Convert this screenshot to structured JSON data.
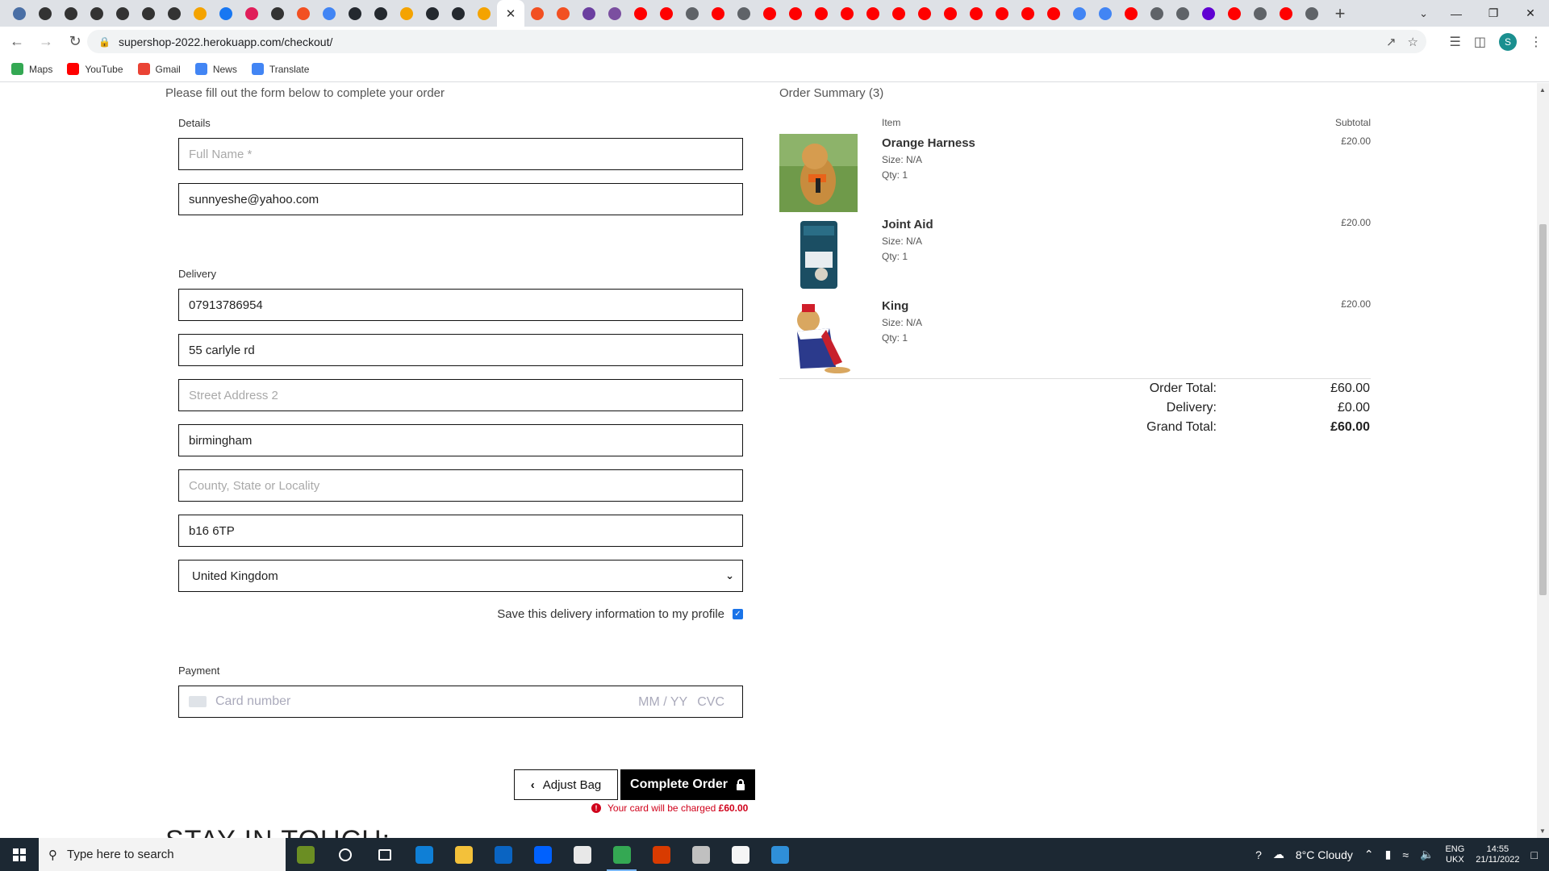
{
  "browser": {
    "url": "supershop-2022.herokuapp.com/checkout/",
    "bookmarks": [
      {
        "label": "Maps",
        "color": "#34a853"
      },
      {
        "label": "YouTube",
        "color": "#ff0000"
      },
      {
        "label": "Gmail",
        "color": "#ea4335"
      },
      {
        "label": "News",
        "color": "#4285f4"
      },
      {
        "label": "Translate",
        "color": "#4285f4"
      }
    ],
    "profile_initial": "S"
  },
  "form": {
    "intro": "Please fill out the form below to complete your order",
    "details_label": "Details",
    "full_name_placeholder": "Full Name *",
    "email_value": "sunnyeshe@yahoo.com",
    "delivery_label": "Delivery",
    "phone_value": "07913786954",
    "street1_value": "55 carlyle rd",
    "street2_placeholder": "Street Address 2",
    "town_value": "birmingham",
    "county_placeholder": "County, State or Locality",
    "postcode_value": "b16 6TP",
    "country_value": "United Kingdom",
    "save_info_label": "Save this delivery information to my profile",
    "payment_label": "Payment",
    "card_placeholder": "Card number",
    "card_expiry_placeholder": "MM / YY",
    "card_cvc_placeholder": "CVC",
    "adjust_bag_label": "Adjust Bag",
    "complete_order_label": "Complete Order",
    "charge_note_prefix": "Your card will be charged",
    "charge_amount": "£60.00",
    "stay_in_touch": "STAY IN TOUCH:"
  },
  "summary": {
    "title": "Order Summary (3)",
    "col_item": "Item",
    "col_subtotal": "Subtotal",
    "items": [
      {
        "name": "Orange Harness",
        "size": "Size: N/A",
        "qty": "Qty: 1",
        "subtotal": "£20.00"
      },
      {
        "name": "Joint Aid",
        "size": "Size: N/A",
        "qty": "Qty: 1",
        "subtotal": "£20.00"
      },
      {
        "name": "King",
        "size": "Size: N/A",
        "qty": "Qty: 1",
        "subtotal": "£20.00"
      }
    ],
    "order_total_label": "Order Total:",
    "order_total": "£60.00",
    "delivery_label": "Delivery:",
    "delivery": "£0.00",
    "grand_total_label": "Grand Total:",
    "grand_total": "£60.00"
  },
  "taskbar": {
    "search_placeholder": "Type here to search",
    "weather": "8°C  Cloudy",
    "lang": "ENG",
    "layout": "UKX",
    "time": "14:55",
    "date": "21/11/2022"
  }
}
